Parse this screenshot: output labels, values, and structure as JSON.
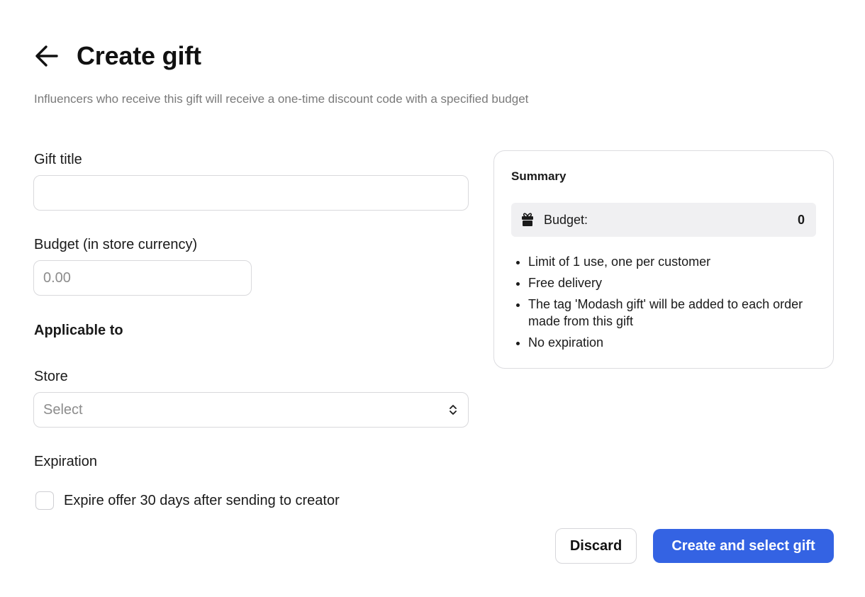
{
  "header": {
    "title": "Create gift",
    "subtitle": "Influencers who receive this gift will receive a one-time discount code with a specified budget"
  },
  "form": {
    "gift_title": {
      "label": "Gift title",
      "value": "",
      "placeholder": ""
    },
    "budget": {
      "label": "Budget (in store currency)",
      "value": "",
      "placeholder": "0.00"
    },
    "applicable_heading": "Applicable to",
    "store": {
      "label": "Store",
      "selected": "Select"
    },
    "expiration": {
      "label": "Expiration",
      "checkbox_label": "Expire offer 30 days after sending to creator",
      "checked": false
    }
  },
  "summary": {
    "title": "Summary",
    "budget_label": "Budget:",
    "budget_value": "0",
    "items": [
      "Limit of 1 use, one per customer",
      "Free delivery",
      "The tag 'Modash gift' will be added to each order made from this gift",
      "No expiration"
    ]
  },
  "actions": {
    "discard_label": "Discard",
    "create_label": "Create and select gift"
  },
  "colors": {
    "primary": "#3463e3",
    "muted_text": "#7a7a7a",
    "border": "#d9d9dc",
    "budget_row_bg": "#f0f0f2"
  },
  "icons": {
    "back": "arrow-left-icon",
    "gift": "gift-icon",
    "select": "chevron-up-down-icon"
  }
}
